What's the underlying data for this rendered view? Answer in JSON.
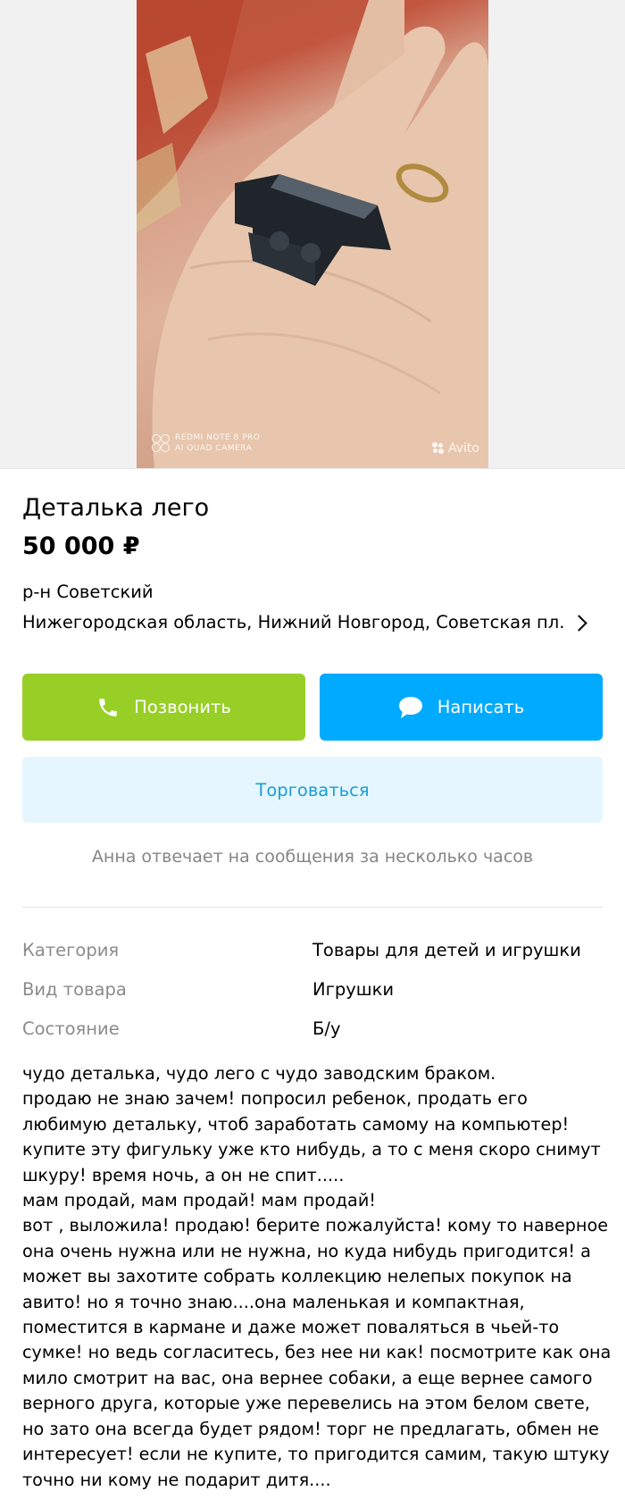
{
  "photo": {
    "camera_watermark_line1": "REDMI NOTE 8 PRO",
    "camera_watermark_line2": "AI QUAD CAMERA",
    "brand_watermark": "Avito"
  },
  "listing": {
    "title": "Деталька лего",
    "price": "50 000 ₽",
    "district": "р-н Советский",
    "address": "Нижегородская область, Нижний Новгород, Советская пл."
  },
  "actions": {
    "call_label": "Позвонить",
    "write_label": "Написать",
    "bargain_label": "Торговаться"
  },
  "seller_note": "Анна отвечает на сообщения за несколько часов",
  "params": [
    {
      "label": "Категория",
      "value": "Товары для детей и игрушки"
    },
    {
      "label": "Вид товара",
      "value": "Игрушки"
    },
    {
      "label": "Состояние",
      "value": "Б/у"
    }
  ],
  "description": "чудо деталька, чудо лего с чудо заводским браком.\nпродаю не знаю зачем! попросил ребенок, продать его любимую деталькy, чтоб заработать самому на компьютер!\nкупите эту фигульку уже кто нибудь, а то с меня скоро снимут шкуру! время ночь, а он не спит.....\nмам продай, мам продай! мам продай!\nвот , выложила! продаю! берите пожалуйста! кому то наверное она очень нужна или не нужна, но куда нибудь пригодится! а может вы захотите собрать коллекцию нелепых покупок на авито! но я точно знаю....она маленькая и компактная, поместится в кармане и даже может поваляться в чьей-то сумке! но ведь согласитесь, без нее ни как! посмотрите как она мило смотрит на вас, она вернее собаки, а еще вернее самого верного друга, которые уже перевелись на этом белом свете, но зато она всегда будет рядом! торг не предлагать, обмен не интересует! если не купите, то пригодится самим, такую штуку точно ни кому не подарит дитя....",
  "colors": {
    "call_button": "#97cf26",
    "write_button": "#00aaff",
    "bargain_button_bg": "#e5f6fe",
    "bargain_button_text": "#1c9ed6"
  }
}
